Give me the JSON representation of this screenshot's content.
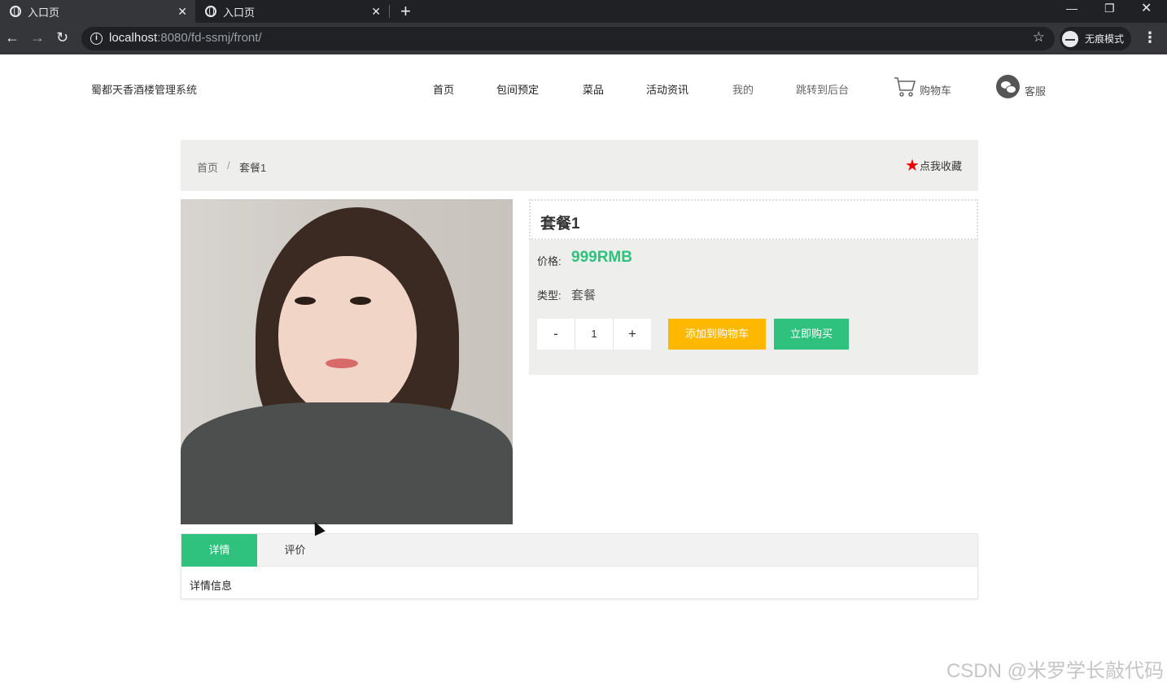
{
  "browser": {
    "tabs": [
      {
        "title": "入口页",
        "active": true
      },
      {
        "title": "入口页",
        "active": false
      }
    ],
    "url_host": "localhost",
    "url_rest": ":8080/fd-ssmj/front/",
    "incognito_label": "无痕模式"
  },
  "site": {
    "title": "蜀都天香酒楼管理系统",
    "nav": [
      "首页",
      "包间预定",
      "菜品",
      "活动资讯",
      "我的",
      "跳转到后台"
    ],
    "cart_label": "购物车",
    "service_label": "客服"
  },
  "breadcrumb": {
    "home": "首页",
    "sep": "/",
    "current": "套餐1",
    "favorite_label": "点我收藏"
  },
  "product": {
    "name": "套餐1",
    "price_label": "价格:",
    "price": "999RMB",
    "type_label": "类型:",
    "type": "套餐",
    "quantity": "1",
    "minus": "-",
    "plus": "+",
    "add_to_cart": "添加到购物车",
    "buy_now": "立即购买"
  },
  "tabs": {
    "items": [
      "详情",
      "评价"
    ],
    "active": "详情",
    "content": "详情信息"
  },
  "watermark": "CSDN @米罗学长敲代码",
  "colors": {
    "accent_green": "#2ec27e",
    "accent_yellow": "#ffb800",
    "favorite_red": "#ee0000"
  }
}
